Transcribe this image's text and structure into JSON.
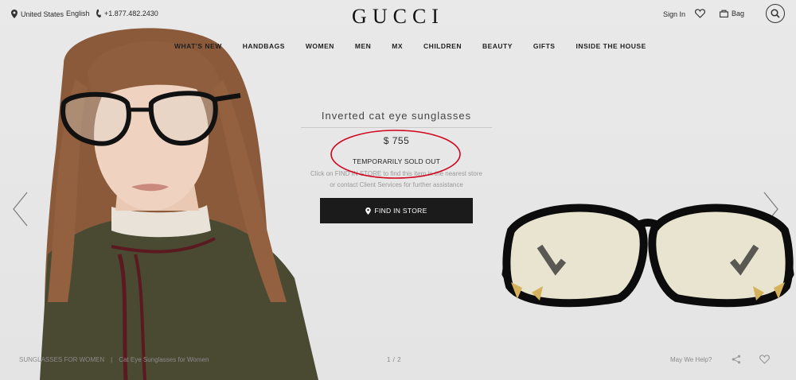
{
  "topbar": {
    "location": "United States",
    "language": "English",
    "phone": "+1.877.482.2430",
    "sign_in": "Sign In",
    "bag": "Bag"
  },
  "brand": {
    "logo": "GUCCI"
  },
  "nav": {
    "items": [
      {
        "label": "WHAT'S NEW"
      },
      {
        "label": "HANDBAGS"
      },
      {
        "label": "WOMEN"
      },
      {
        "label": "MEN"
      },
      {
        "label": "MX"
      },
      {
        "label": "CHILDREN"
      },
      {
        "label": "BEAUTY"
      },
      {
        "label": "GIFTS"
      },
      {
        "label": "INSIDE THE HOUSE"
      }
    ]
  },
  "product": {
    "title": "Inverted cat eye sunglasses",
    "price": "$ 755",
    "availability": "TEMPORARILY SOLD OUT",
    "help_line1": "Click on FIND IN STORE to find this item in the nearest store",
    "help_line2": "or contact Client Services for further assistance",
    "find_in_store": "FIND IN STORE"
  },
  "footer": {
    "breadcrumb": [
      "SUNGLASSES FOR WOMEN",
      "Cat Eye Sunglasses for Women"
    ],
    "breadcrumb_separator": "|",
    "pager": "1 / 2",
    "may_we_help": "May We Help?"
  },
  "icons": {
    "location": "location-pin-icon",
    "phone": "phone-icon",
    "wishlist": "heart-icon",
    "bag": "bag-icon",
    "search": "search-icon",
    "prev": "chevron-left-icon",
    "next": "chevron-right-icon",
    "share": "share-icon"
  },
  "colors": {
    "annotation": "#d0021b",
    "button": "#1b1b1b"
  }
}
